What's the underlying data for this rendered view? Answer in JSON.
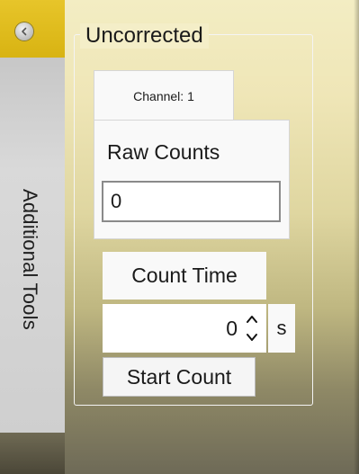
{
  "side_panel": {
    "label": "Additional Tools",
    "collapse_icon": "chevron-left-icon"
  },
  "group": {
    "title": "Uncorrected"
  },
  "tab": {
    "label": "Channel: 1"
  },
  "raw_counts": {
    "label": "Raw Counts",
    "value": "0"
  },
  "count_time": {
    "label": "Count Time",
    "value": "0",
    "unit": "s",
    "spinner_icons": [
      "spin-up-icon",
      "spin-down-icon"
    ]
  },
  "actions": {
    "start_label": "Start Count"
  },
  "colors": {
    "accent_gold": "#d8b312",
    "panel_top": "#f3edc3",
    "panel_bottom": "#6e6a57"
  }
}
